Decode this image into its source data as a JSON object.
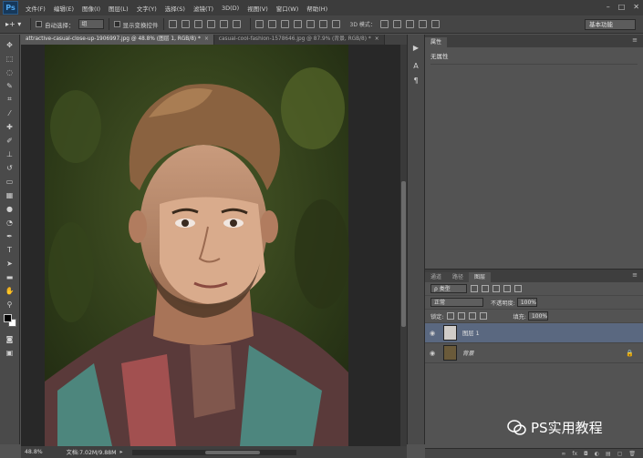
{
  "app": {
    "logo": "Ps"
  },
  "menu": [
    "文件(F)",
    "编辑(E)",
    "图像(I)",
    "图层(L)",
    "文字(Y)",
    "选择(S)",
    "滤镜(T)",
    "3D(D)",
    "视图(V)",
    "窗口(W)",
    "帮助(H)"
  ],
  "options_bar": {
    "tool_label": "▸+ ▾",
    "auto_select_label": "自动选择：",
    "auto_select_value": "组",
    "show_transform_label": "显示变换控件",
    "mode_3d_label": "3D 模式：",
    "workspace": "基本功能"
  },
  "tabs": [
    {
      "label": "attractive-casual-close-up-1906997.jpg @ 48.8% (图层 1, RGB/8) *",
      "active": true
    },
    {
      "label": "casual-cool-fashion-1578646.jpg @ 87.9% (背景, RGB/8) *",
      "active": false
    }
  ],
  "status": {
    "zoom": "48.8%",
    "doc_info": "文档:7.02M/9.88M"
  },
  "properties": {
    "tab": "属性",
    "empty": "无属性"
  },
  "layers_panel": {
    "tabs": [
      "通道",
      "路径",
      "图层"
    ],
    "filter_kind": "ρ 类型",
    "blend_mode": "正常",
    "opacity_label": "不透明度:",
    "opacity_value": "100%",
    "lock_label": "锁定:",
    "fill_label": "填充:",
    "fill_value": "100%",
    "layers": [
      {
        "name": "图层 1",
        "selected": true
      },
      {
        "name": "背景",
        "selected": false,
        "locked": true
      }
    ]
  },
  "watermark": "PS实用教程",
  "colors": {
    "accent": "#5a6880",
    "canvas_bg": "#282828",
    "panel": "#535353"
  }
}
